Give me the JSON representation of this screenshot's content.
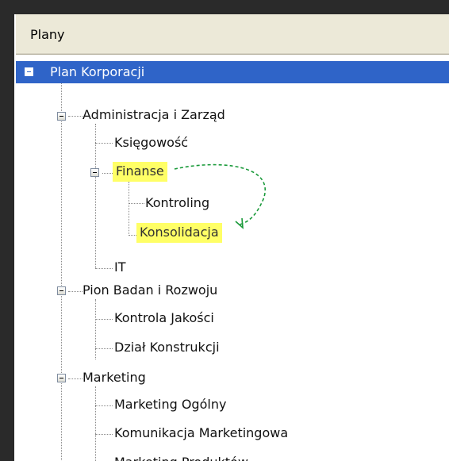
{
  "header": {
    "title": "Plany"
  },
  "tree": {
    "root": "Plan Korporacji",
    "items": [
      "Administracja i Zarząd",
      "Księgowość",
      "Finanse",
      "Kontroling",
      "Konsolidacja",
      "IT",
      "Pion Badan i Rozwoju",
      "Kontrola Jakości",
      "Dział Konstrukcji",
      "Marketing",
      "Marketing Ogólny",
      "Komunikacja Marketingowa",
      "Marketing Produktów"
    ],
    "highlighted": [
      "Finanse",
      "Konsolidacja"
    ]
  },
  "colors": {
    "selection": "#2f64c8",
    "highlight": "#ffff66",
    "arrow": "#1a9a3a"
  }
}
